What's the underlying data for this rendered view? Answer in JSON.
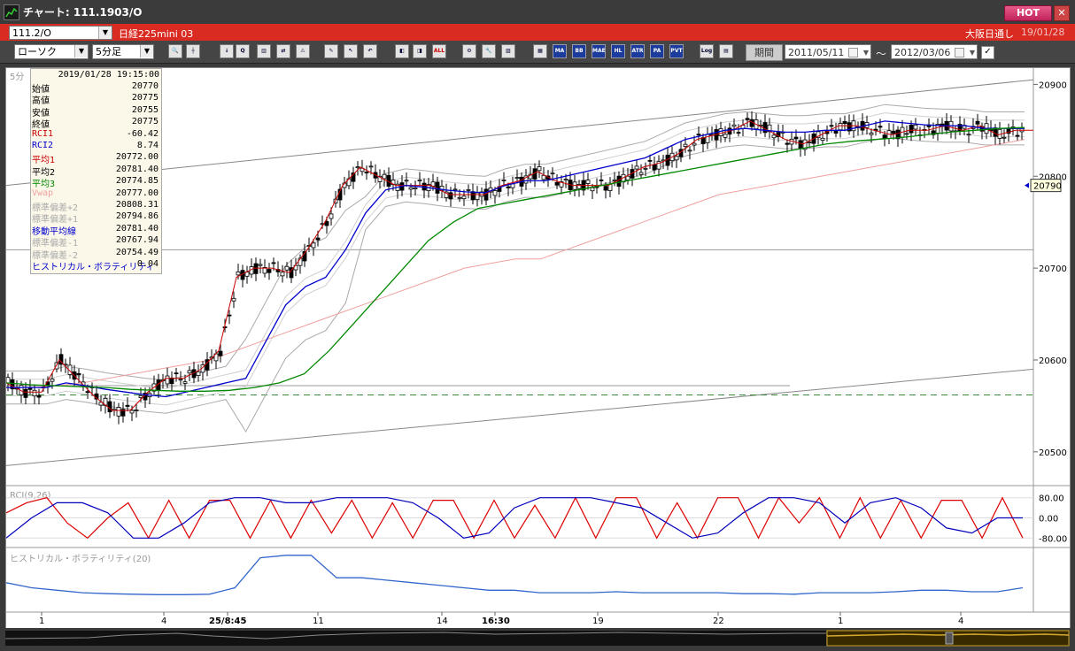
{
  "window": {
    "title": "チャート: 111.1903/O",
    "hot_label": "HOT",
    "close_label": "✕"
  },
  "symbol_bar": {
    "symbol_select": "111.2/O",
    "symbol_name": "日経225mini 03",
    "session": "大阪日通し",
    "date": "19/01/28"
  },
  "toolbar": {
    "chart_type": "ローソク",
    "timeframe": "5分足",
    "period_button": "期間",
    "date_from": "2011/05/11",
    "date_to": "2012/03/06",
    "tilde": "〜",
    "check": "✓",
    "icons": [
      {
        "name": "zoom-icon",
        "text": "🔍"
      },
      {
        "name": "crosshair-icon",
        "text": "┼"
      },
      {
        "name": "download-icon",
        "text": "↓"
      },
      {
        "name": "search-chart-icon",
        "text": "Q"
      },
      {
        "name": "bar-chart-icon",
        "text": "▥"
      },
      {
        "name": "split-icon",
        "text": "⇄"
      },
      {
        "name": "warning-icon",
        "text": "⚠"
      },
      {
        "name": "pen-icon",
        "text": "✎"
      },
      {
        "name": "cursor-icon",
        "text": "↖"
      },
      {
        "name": "undo-icon",
        "text": "↶"
      },
      {
        "name": "candle-left-icon",
        "text": "◧"
      },
      {
        "name": "candle-right-icon",
        "text": "◨"
      },
      {
        "name": "all-icon",
        "text": "ALL"
      },
      {
        "name": "settings-icon",
        "text": "⚙"
      },
      {
        "name": "tools-icon",
        "text": "🔧"
      },
      {
        "name": "color-icon",
        "text": "▨"
      },
      {
        "name": "grid-icon",
        "text": "▦"
      },
      {
        "name": "ma-icon",
        "text": "MA"
      },
      {
        "name": "bb-icon",
        "text": "BB"
      },
      {
        "name": "mae-icon",
        "text": "MAE"
      },
      {
        "name": "hl-icon",
        "text": "HL"
      },
      {
        "name": "atr-icon",
        "text": "ATR"
      },
      {
        "name": "para-icon",
        "text": "PA RA"
      },
      {
        "name": "pvt-icon",
        "text": "PVT"
      },
      {
        "name": "log-icon",
        "text": "Log"
      },
      {
        "name": "export-icon",
        "text": "▤"
      }
    ]
  },
  "info_panel": {
    "datetime": "2019/01/28  19:15:00",
    "rows": [
      {
        "label": "始値",
        "value": "20770",
        "color": "#000000"
      },
      {
        "label": "高値",
        "value": "20775",
        "color": "#000000"
      },
      {
        "label": "安値",
        "value": "20755",
        "color": "#000000"
      },
      {
        "label": "終値",
        "value": "20775",
        "color": "#000000"
      },
      {
        "label": "RCI1",
        "value": "-60.42",
        "color": "#cc0000"
      },
      {
        "label": "RCI2",
        "value": "8.74",
        "color": "#0000cc"
      },
      {
        "label": "平均1",
        "value": "20772.00",
        "color": "#cc0000"
      },
      {
        "label": "平均2",
        "value": "20781.40",
        "color": "#000000"
      },
      {
        "label": "平均3",
        "value": "20774.85",
        "color": "#008800"
      },
      {
        "label": "Vwap",
        "value": "20777.00",
        "color": "#f0a0a0"
      },
      {
        "label": "標準偏差+2",
        "value": "20808.31",
        "color": "#aaaaaa"
      },
      {
        "label": "標準偏差+1",
        "value": "20794.86",
        "color": "#aaaaaa"
      },
      {
        "label": "移動平均線",
        "value": "20781.40",
        "color": "#0000cc"
      },
      {
        "label": "標準偏差-1",
        "value": "20767.94",
        "color": "#aaaaaa"
      },
      {
        "label": "標準偏差-2",
        "value": "20754.49",
        "color": "#aaaaaa"
      },
      {
        "label": "ヒストリカル・ボラティリティ",
        "value": "0.04",
        "color": "#0000cc"
      }
    ]
  },
  "chart_data": {
    "type": "line",
    "interval_label": "5分",
    "price_ticks": [
      "20900",
      "20800",
      "20700",
      "20600",
      "20500"
    ],
    "ylim": [
      20470,
      20910
    ],
    "current_price": "20790",
    "x_labels": [
      "1",
      "4",
      "25/8:45",
      "11",
      "14",
      "16:30",
      "19",
      "22",
      "1",
      "4"
    ],
    "rci_label": "RCI(9,26)",
    "rci_ticks": [
      "80.00",
      "0.00",
      "-80.00"
    ],
    "rci_ylim": [
      -100,
      100
    ],
    "hv_label": "ヒストリカル・ボラティリティ(20)",
    "colors": {
      "ma1": "#cc0000",
      "ma2": "#0000cc",
      "ma3": "#008800",
      "vwap": "#f0a0a0",
      "band": "#aaaaaa",
      "rci1": "#dd0000",
      "rci2": "#0000bb",
      "hv": "#3366cc"
    },
    "close_x": [
      0,
      20,
      40,
      60,
      80,
      100,
      120,
      140,
      160,
      180,
      200,
      220,
      240,
      260,
      280,
      300,
      320,
      340,
      360,
      380,
      400,
      420,
      440,
      460,
      480,
      500,
      520,
      540,
      560,
      580,
      600,
      620,
      640,
      660,
      680,
      700,
      720,
      740,
      760,
      780,
      800,
      820,
      840,
      860,
      880,
      900,
      920,
      940,
      960,
      980,
      1000,
      1020,
      1040,
      1060,
      1080,
      1100,
      1120,
      1140,
      1160
    ],
    "close": [
      20575,
      20565,
      20565,
      20600,
      20580,
      20560,
      20545,
      20545,
      20565,
      20580,
      20580,
      20590,
      20610,
      20690,
      20700,
      20700,
      20695,
      20720,
      20750,
      20790,
      20810,
      20800,
      20790,
      20790,
      20790,
      20780,
      20780,
      20780,
      20790,
      20795,
      20805,
      20795,
      20790,
      20790,
      20790,
      20800,
      20810,
      20815,
      20825,
      20840,
      20845,
      20850,
      20860,
      20850,
      20840,
      20835,
      20845,
      20855,
      20855,
      20850,
      20845,
      20850,
      20850,
      20855,
      20850,
      20855,
      20845,
      20850,
      20850
    ],
    "ma2": [
      20570,
      20570,
      20570,
      20575,
      20572,
      20568,
      20565,
      20562,
      20560,
      20565,
      20570,
      20575,
      20580,
      20620,
      20660,
      20680,
      20690,
      20720,
      20760,
      20785,
      20790,
      20788,
      20785,
      20783,
      20782,
      20790,
      20795,
      20795,
      20800,
      20805,
      20810,
      20815,
      20820,
      20830,
      20840,
      20845,
      20850,
      20852,
      20850,
      20848,
      20848,
      20850,
      20850,
      20855,
      20860,
      20858,
      20856,
      20855,
      20855,
      20852,
      20852,
      20852
    ],
    "ma3": [
      20575,
      20573,
      20572,
      20571,
      20570,
      20568,
      20567,
      20566,
      20566,
      20567,
      20570,
      20575,
      20585,
      20610,
      20640,
      20670,
      20700,
      20730,
      20750,
      20765,
      20770,
      20775,
      20780,
      20785,
      20790,
      20795,
      20800,
      20805,
      20810,
      20815,
      20820,
      20825,
      20830,
      20835,
      20838,
      20840,
      20842,
      20845,
      20848,
      20850,
      20852,
      20853
    ],
    "rci1": [
      20,
      60,
      80,
      -20,
      -80,
      0,
      60,
      -80,
      70,
      -80,
      70,
      70,
      -80,
      70,
      -80,
      70,
      -60,
      70,
      -80,
      60,
      -80,
      70,
      70,
      -80,
      70,
      -80,
      50,
      -80,
      80,
      -80,
      80,
      80,
      -80,
      60,
      -80,
      80,
      80,
      -80,
      80,
      -20,
      80,
      -80,
      80,
      -80,
      70,
      -80,
      70,
      70,
      -80,
      80,
      -80
    ],
    "rci2": [
      -80,
      0,
      60,
      60,
      20,
      -80,
      -80,
      -20,
      60,
      80,
      80,
      60,
      60,
      80,
      80,
      80,
      60,
      0,
      -80,
      -60,
      40,
      80,
      80,
      80,
      60,
      40,
      -20,
      -80,
      -60,
      20,
      80,
      80,
      60,
      -20,
      60,
      80,
      40,
      -40,
      -60,
      0,
      0
    ],
    "hv": [
      0.05,
      0.04,
      0.035,
      0.03,
      0.028,
      0.027,
      0.026,
      0.026,
      0.027,
      0.04,
      0.1,
      0.105,
      0.105,
      0.06,
      0.06,
      0.055,
      0.05,
      0.045,
      0.04,
      0.035,
      0.035,
      0.03,
      0.03,
      0.03,
      0.032,
      0.03,
      0.03,
      0.03,
      0.03,
      0.028,
      0.028,
      0.027,
      0.03,
      0.03,
      0.03,
      0.032,
      0.035,
      0.035,
      0.032,
      0.032,
      0.04
    ]
  }
}
